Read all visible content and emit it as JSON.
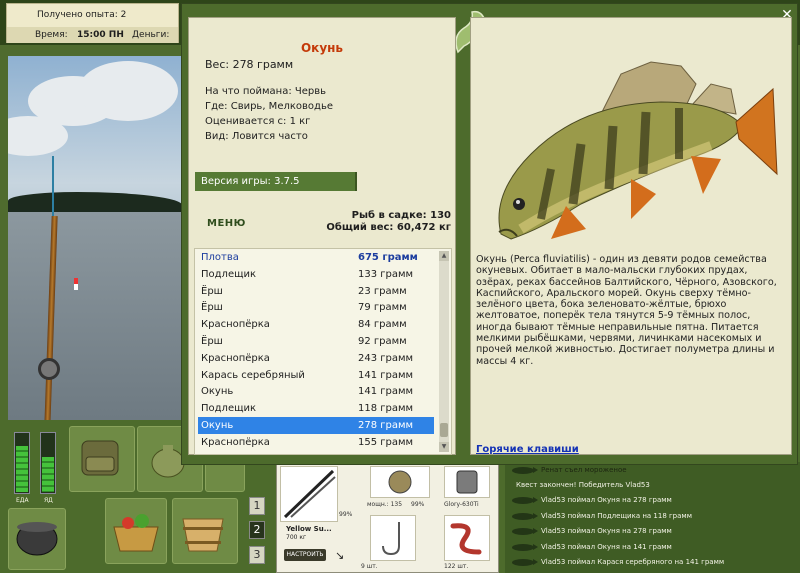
{
  "hud": {
    "experience": "Получено опыта: 2",
    "time_label": "Время:",
    "time_value": "15:00 ПН",
    "money_label": "Деньги:",
    "meter_food": "ЕДА",
    "meter_drink": "ЯД",
    "meter_food_level": 0.8,
    "meter_drink_level": 0.6,
    "slot_numbers": [
      "1",
      "2",
      "3"
    ]
  },
  "tackle": {
    "rod_name": "Yellow Su...",
    "rod_weight": "700 кг",
    "rod_percent": "99%",
    "reel_label": "мощн.: 135",
    "reel_percent": "99%",
    "line_label": "Glory-630Ti",
    "hook_count": "9 шт.",
    "bait_count": "122 шт.",
    "setup_button": "НАСТРОИТЬ"
  },
  "chat": [
    "Ренат съел мороженое",
    "Квест закончен! Победитель Vlad53",
    "Vlad53 поймал Окуня на 278 грамм",
    "Vlad53 поймал Подлещика на 118 грамм",
    "Vlad53 поймал Окуня на 278 грамм",
    "Vlad53 поймал Окуня на 141 грамм",
    "Vlad53 поймал Карася серебряного на 141 грамм"
  ],
  "fish": {
    "name": "Окунь",
    "weight": "Вес: 278 грамм",
    "caught_on": "На что поймана: Червь",
    "where": "Где: Свирь, Мелководье",
    "valued_from": "Оценивается с: 1 кг",
    "type": "Вид: Ловится часто",
    "description": "Окунь (Perca fluviatilis) - один из девяти родов семейства окуневых. Обитает в мало-мальски глубоких прудах, озёрах, реках бассейнов Балтийского, Чёрного, Азовского, Каспийского, Аральского морей. Окунь сверху тёмно-зелёного цвета, бока зеленовато-жёлтые, брюхо желтоватое, поперёк тела тянутся 5-9 тёмных полос, иногда бывают тёмные неправильные пятна. Питается мелкими рыбёшками, червями, личинками насекомых и прочей мелкой живностью. Достигает полуметра длины и массы 4 кг."
  },
  "game_version": "Версия игры: 3.7.5",
  "menu_label": "МЕНЮ",
  "keepnet": {
    "count": "Рыб в садке: 130",
    "total": "Общий вес: 60,472 кг"
  },
  "catches": [
    {
      "name": "Плотва",
      "weight": "675 грамм"
    },
    {
      "name": "Подлещик",
      "weight": "133 грамм"
    },
    {
      "name": "Ёрш",
      "weight": "23 грамм"
    },
    {
      "name": "Ёрш",
      "weight": "79 грамм"
    },
    {
      "name": "Краснопёрка",
      "weight": "84 грамм"
    },
    {
      "name": "Ёрш",
      "weight": "92 грамм"
    },
    {
      "name": "Краснопёрка",
      "weight": "243 грамм"
    },
    {
      "name": "Карась серебряный",
      "weight": "141 грамм"
    },
    {
      "name": "Окунь",
      "weight": "141 грамм"
    },
    {
      "name": "Подлещик",
      "weight": "118 грамм"
    },
    {
      "name": "Окунь",
      "weight": "278 грамм"
    },
    {
      "name": "Краснопёрка",
      "weight": "155 грамм"
    }
  ],
  "selected_index": 10,
  "hotkeys_link": "Горячие клавиши",
  "close_glyph": "✕",
  "colors": {
    "accent_green": "#4d6b2c",
    "fish_title": "#c43a09",
    "selection": "#2f83e6",
    "link": "#1432b5"
  },
  "icons": [
    "close-icon",
    "lizard-icon",
    "fish-icon",
    "backpack-icon",
    "basket-icon",
    "bucket-icon",
    "pot-icon"
  ]
}
